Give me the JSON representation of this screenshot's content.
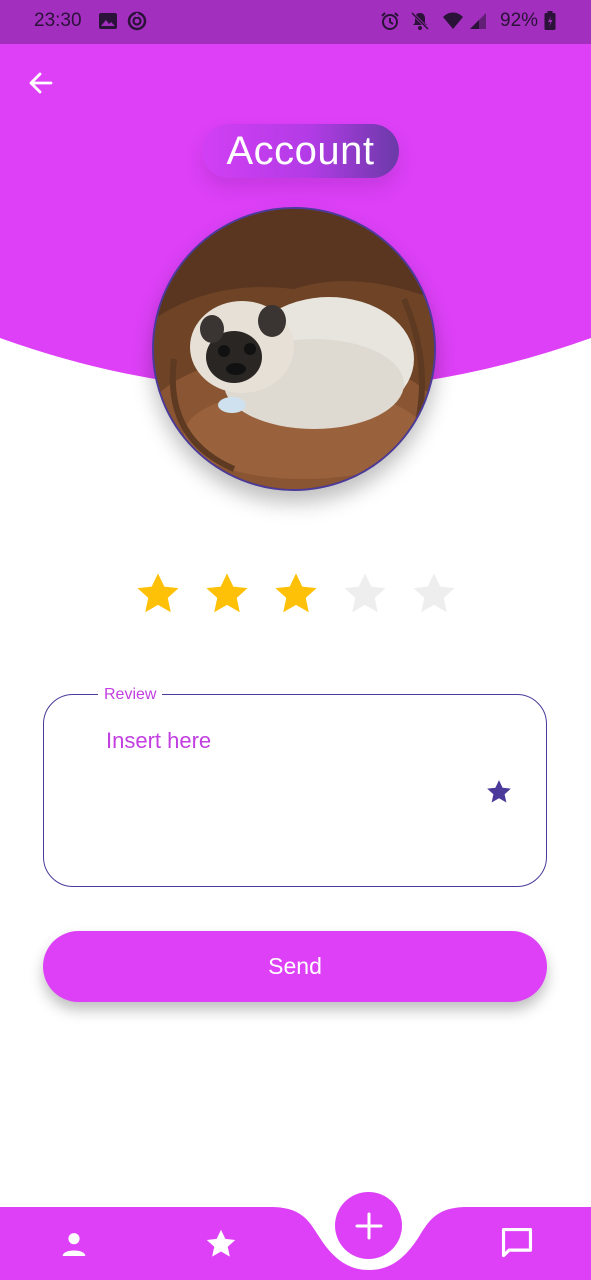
{
  "status_bar": {
    "time": "23:30",
    "battery": "92%",
    "icons": [
      "image-icon",
      "sync-icon",
      "alarm-icon",
      "notifications-off-icon",
      "wifi-icon",
      "signal-icon",
      "battery-icon"
    ]
  },
  "header": {
    "back_icon": "arrow-left-icon",
    "title": "Account",
    "color": "#dd40f7"
  },
  "avatar": {
    "alt": "pug dog photo"
  },
  "rating": {
    "value": 3,
    "max": 5,
    "filled_color": "#ffc107",
    "empty_color": "#eeeeee"
  },
  "review": {
    "label": "Review",
    "placeholder": "Insert here",
    "value": "",
    "suffix_icon": "star-icon"
  },
  "actions": {
    "send_label": "Send"
  },
  "bottom_nav": {
    "items": [
      "person-icon",
      "star-icon",
      "add-icon",
      "chat-icon"
    ]
  },
  "colors": {
    "primary": "#dd40f7",
    "accent": "#4b3a9a",
    "status_bar": "#a22fbe"
  }
}
